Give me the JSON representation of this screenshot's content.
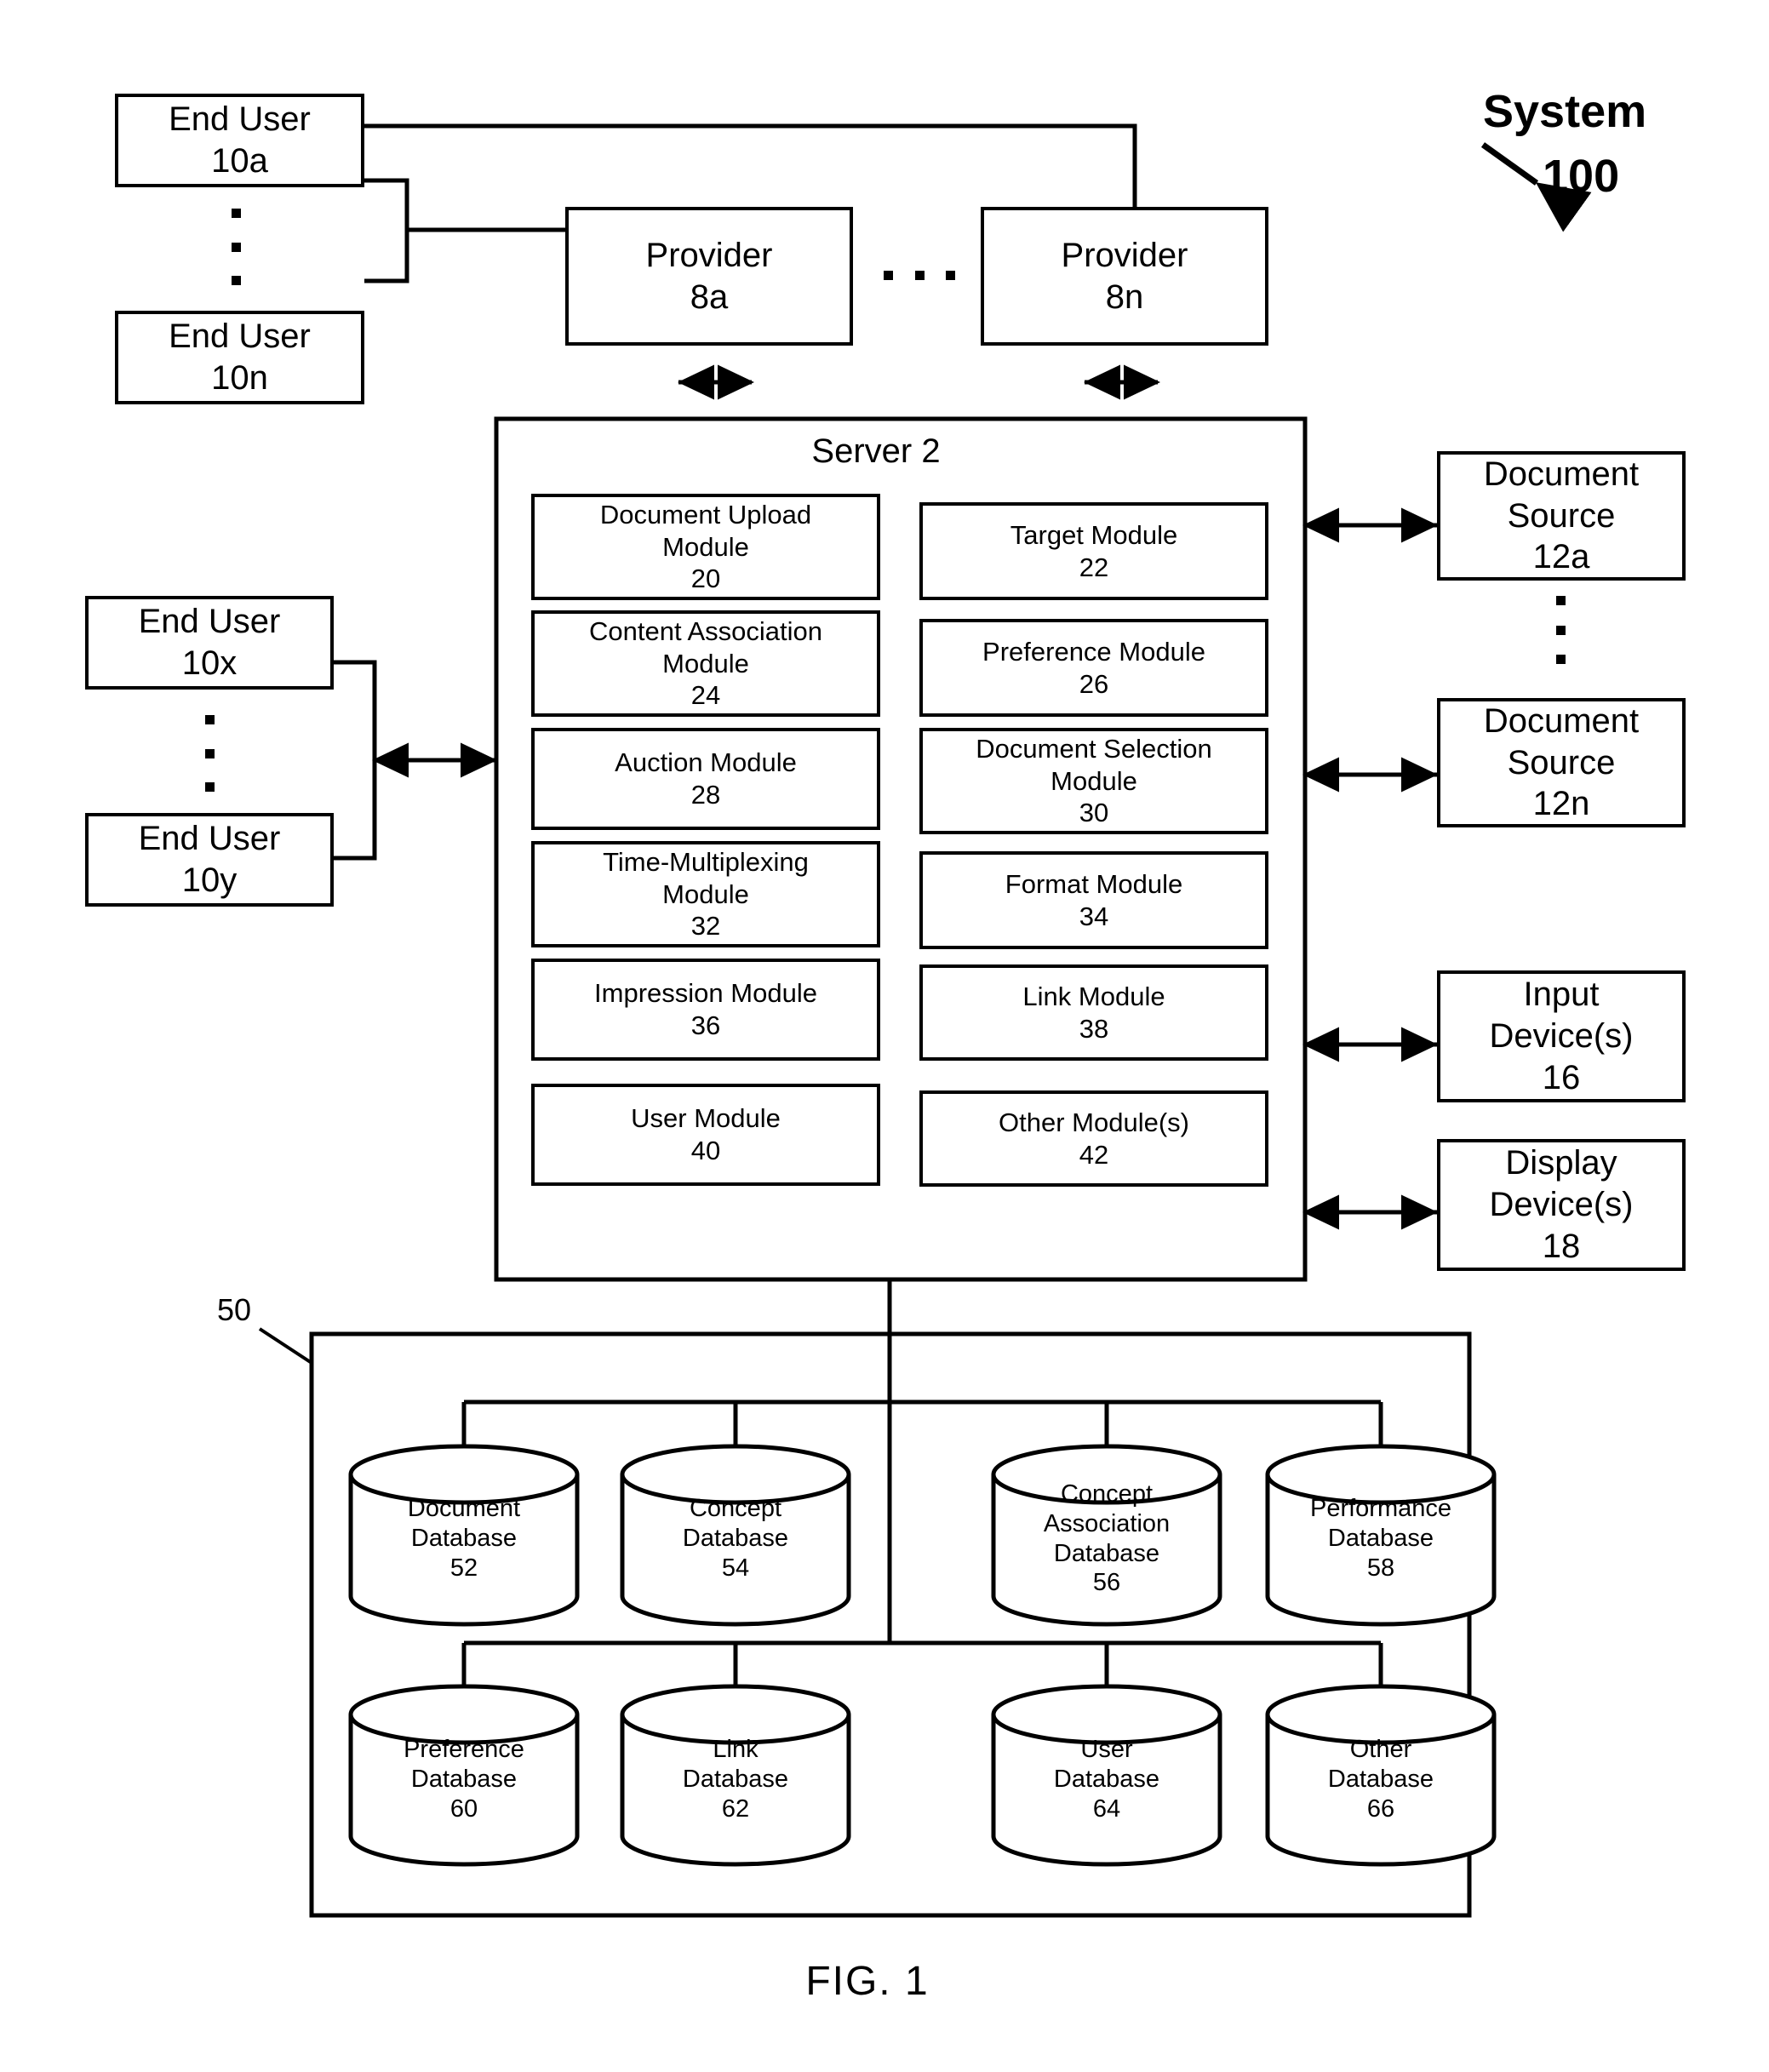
{
  "figure": {
    "caption": "FIG. 1",
    "system_label": "System",
    "system_number": "100",
    "group_ref": "50"
  },
  "end_users_top": [
    {
      "name": "End User",
      "ref": "10a"
    },
    {
      "name": "End User",
      "ref": "10n"
    }
  ],
  "end_users_left": [
    {
      "name": "End User",
      "ref": "10x"
    },
    {
      "name": "End User",
      "ref": "10y"
    }
  ],
  "providers": [
    {
      "name": "Provider",
      "ref": "8a"
    },
    {
      "name": "Provider",
      "ref": "8n"
    }
  ],
  "server": {
    "title": "Server 2",
    "modules_left": [
      {
        "name": "Document Upload Module",
        "line1": "Document Upload",
        "line2": "Module",
        "ref": "20"
      },
      {
        "name": "Content Association Module",
        "line1": "Content Association",
        "line2": "Module",
        "ref": "24"
      },
      {
        "name": "Auction Module",
        "line1": "Auction Module",
        "line2": "",
        "ref": "28"
      },
      {
        "name": "Time-Multiplexing Module",
        "line1": "Time-Multiplexing",
        "line2": "Module",
        "ref": "32"
      },
      {
        "name": "Impression Module",
        "line1": "Impression Module",
        "line2": "",
        "ref": "36"
      },
      {
        "name": "User Module",
        "line1": "User Module",
        "line2": "",
        "ref": "40"
      }
    ],
    "modules_right": [
      {
        "name": "Target Module",
        "line1": "Target Module",
        "line2": "",
        "ref": "22"
      },
      {
        "name": "Preference Module",
        "line1": "Preference Module",
        "line2": "",
        "ref": "26"
      },
      {
        "name": "Document Selection Module",
        "line1": "Document Selection",
        "line2": "Module",
        "ref": "30"
      },
      {
        "name": "Format Module",
        "line1": "Format Module",
        "line2": "",
        "ref": "34"
      },
      {
        "name": "Link Module",
        "line1": "Link Module",
        "line2": "",
        "ref": "38"
      },
      {
        "name": "Other Module(s)",
        "line1": "Other Module(s)",
        "line2": "",
        "ref": "42"
      }
    ]
  },
  "peripherals": [
    {
      "line1": "Document",
      "line2": "Source",
      "ref": "12a"
    },
    {
      "line1": "Document",
      "line2": "Source",
      "ref": "12n"
    },
    {
      "line1": "Input",
      "line2": "Device(s)",
      "ref": "16"
    },
    {
      "line1": "Display",
      "line2": "Device(s)",
      "ref": "18"
    }
  ],
  "databases_row1": [
    {
      "line1": "Document",
      "line2": "Database",
      "line3": "",
      "ref": "52"
    },
    {
      "line1": "Concept",
      "line2": "Database",
      "line3": "",
      "ref": "54"
    },
    {
      "line1": "Concept",
      "line2": "Association",
      "line3": "Database",
      "ref": "56"
    },
    {
      "line1": "Performance",
      "line2": "Database",
      "line3": "",
      "ref": "58"
    }
  ],
  "databases_row2": [
    {
      "line1": "Preference",
      "line2": "Database",
      "line3": "",
      "ref": "60"
    },
    {
      "line1": "Link",
      "line2": "Database",
      "line3": "",
      "ref": "62"
    },
    {
      "line1": "User",
      "line2": "Database",
      "line3": "",
      "ref": "64"
    },
    {
      "line1": "Other",
      "line2": "Database",
      "line3": "",
      "ref": "66"
    }
  ],
  "colors": {
    "ink": "#000000",
    "paper": "#ffffff"
  }
}
